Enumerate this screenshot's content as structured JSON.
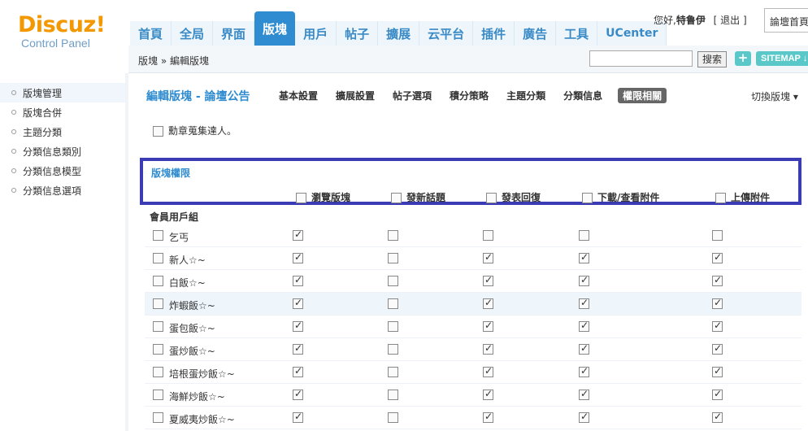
{
  "logo": {
    "main": "Discuz!",
    "sub": "Control Panel"
  },
  "nav": [
    "首頁",
    "全局",
    "界面",
    "版塊",
    "用戶",
    "帖子",
    "擴展",
    "云平台",
    "插件",
    "廣告",
    "工具",
    "UCenter"
  ],
  "nav_active_index": 3,
  "user": {
    "greeting": "您好,",
    "name": "特鲁伊",
    "logout": "[ 退出 ]"
  },
  "quick": {
    "label": "論壇首頁"
  },
  "breadcrumb": "版塊 » 編輯版塊",
  "search": {
    "value": "",
    "button": "搜索"
  },
  "toolbar": {
    "plus": "+",
    "sitemap": "SITEMAP ↓"
  },
  "sidebar": {
    "items": [
      {
        "label": "版塊管理",
        "active": true
      },
      {
        "label": "版塊合併",
        "active": false
      },
      {
        "label": "主題分類",
        "active": false
      },
      {
        "label": "分類信息類別",
        "active": false
      },
      {
        "label": "分類信息模型",
        "active": false
      },
      {
        "label": "分類信息選項",
        "active": false
      }
    ]
  },
  "page": {
    "title": "編輯版塊 - 論壇公告",
    "tabs": [
      {
        "label": "基本設置",
        "active": false
      },
      {
        "label": "擴展設置",
        "active": false
      },
      {
        "label": "帖子選項",
        "active": false
      },
      {
        "label": "積分策略",
        "active": false
      },
      {
        "label": "主題分類",
        "active": false
      },
      {
        "label": "分類信息",
        "active": false
      },
      {
        "label": "權限相關",
        "active": true
      }
    ],
    "switch_label": "切換版塊 ▾",
    "medal_label": "勳章蒐集達人。"
  },
  "permissions": {
    "section_title": "版塊權限",
    "columns": [
      "瀏覽版塊",
      "發新話題",
      "發表回復",
      "下載/查看附件",
      "上傳附件"
    ],
    "group_title": "會員用戶組",
    "rows": [
      {
        "name": "乞丐",
        "checks": [
          true,
          false,
          false,
          false,
          false
        ]
      },
      {
        "name": "新人☆~",
        "checks": [
          true,
          false,
          true,
          true,
          true
        ]
      },
      {
        "name": "白飯☆~",
        "checks": [
          true,
          false,
          true,
          true,
          true
        ]
      },
      {
        "name": "炸蝦飯☆~",
        "checks": [
          true,
          false,
          true,
          true,
          true
        ],
        "highlight": true
      },
      {
        "name": "蛋包飯☆~",
        "checks": [
          true,
          false,
          true,
          true,
          true
        ]
      },
      {
        "name": "蛋炒飯☆~",
        "checks": [
          true,
          false,
          true,
          true,
          true
        ]
      },
      {
        "name": "培根蛋炒飯☆~",
        "checks": [
          true,
          false,
          true,
          true,
          true
        ]
      },
      {
        "name": "海鮮炒飯☆~",
        "checks": [
          true,
          false,
          true,
          true,
          true
        ]
      },
      {
        "name": "夏威夷炒飯☆~",
        "checks": [
          true,
          false,
          true,
          true,
          true
        ]
      }
    ]
  }
}
